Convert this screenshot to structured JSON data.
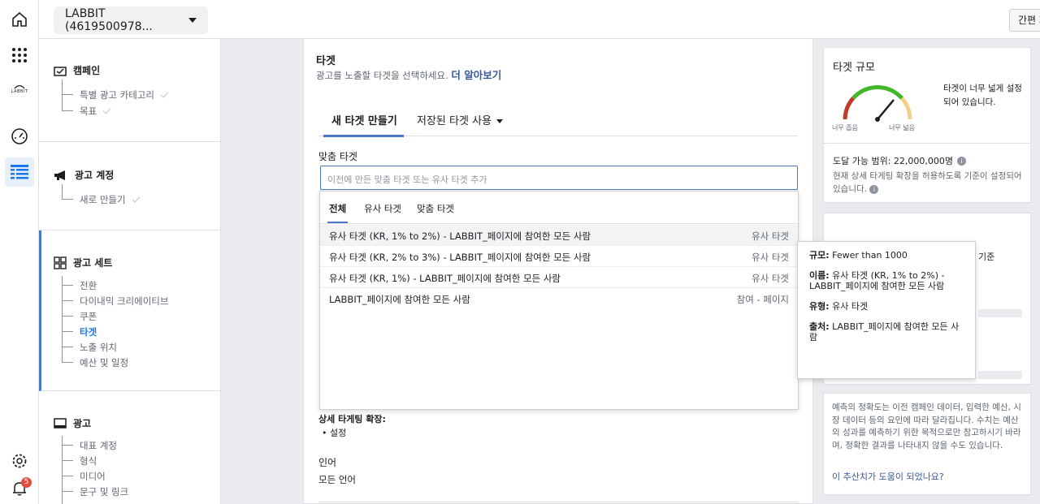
{
  "topbar": {
    "account_label": "LABBIT (4619500978...",
    "quick_label": "간편 제"
  },
  "rail": {
    "notification_count": "5",
    "logo_text": "LABBIT"
  },
  "nav": {
    "campaign": {
      "title": "캠페인",
      "items": [
        "특별 광고 카테고리",
        "목표"
      ]
    },
    "ad_account": {
      "title": "광고 계정",
      "items": [
        "새로 만들기"
      ]
    },
    "ad_set": {
      "title": "광고 세트",
      "items": [
        "전환",
        "다이내믹 크리에이티브",
        "쿠폰",
        "타겟",
        "노출 위치",
        "예산 및 일정"
      ]
    },
    "ad": {
      "title": "광고",
      "items": [
        "대표 계정",
        "형식",
        "미디어",
        "문구 및 링크"
      ]
    }
  },
  "main": {
    "title": "타겟",
    "description": "광고를 노출할 타겟을 선택하세요.",
    "learn_more": "더 알아보기",
    "tabs": [
      "새 타겟 만들기",
      "저장된 타겟 사용"
    ],
    "custom_audience_label": "맞춤 타겟",
    "search_placeholder": "이전에 만든 맞춤 타겟 또는 유사 타겟 추가",
    "detail_expansion_label": "상세 타게팅 확장:",
    "detail_expansion_value": "설정",
    "language_label": "인어",
    "language_value": "모든 언어"
  },
  "dropdown": {
    "tabs": [
      "전체",
      "유사 타겟",
      "맞춤 타겟"
    ],
    "rows": [
      {
        "name": "유사 타겟 (KR, 1% to 2%) - LABBIT_페이지에 참여한 모든 사람",
        "type": "유사 타겟"
      },
      {
        "name": "유사 타겟 (KR, 2% to 3%) - LABBIT_페이지에 참여한 모든 사람",
        "type": "유사 타겟"
      },
      {
        "name": "유사 타겟 (KR, 1%) - LABBIT_페이지에 참여한 모든 사람",
        "type": "유사 타겟"
      },
      {
        "name": "LABBIT_페이지에 참여한 모든 사람",
        "type": "참여 - 페이지"
      }
    ]
  },
  "tooltip": {
    "size_label": "규모:",
    "size_value": "Fewer than 1000",
    "name_label": "이름:",
    "name_value": "유사 타겟 (KR, 1% to 2%) - LABBIT_페이지에 참여한 모든 사람",
    "type_label": "유형:",
    "type_value": "유사 타겟",
    "source_label": "출처:",
    "source_value": "LABBIT_페이지에 참여한 모든 사람"
  },
  "right": {
    "title": "타겟 규모",
    "gauge_narrow": "너무 좁음",
    "gauge_wide": "너무 넓음",
    "gauge_message": "타겟이 너무 넓게 설정되어 있습니다.",
    "reach_label": "도달 가능 범위: 22,000,000명",
    "reach_note": "현재 상세 타게팅 확장을 허용하도록 기준이 설정되어 있습니다.",
    "partial_text": "기준",
    "accuracy_note": "예측의 정확도는 이전 캠페인 데이터, 입력한 예산, 시장 데이터 등의 요인에 따라 달라집니다. 수치는 예산의 성과를 예측하기 위한 목적으로만 참고하시기 바라며, 정확한 결과를 나타내지 않을 수도 있습니다.",
    "feedback_link": "이 추산치가 도움이 되었나요?"
  },
  "colors": {
    "accent": "#4a78c4",
    "link": "#385898",
    "badge": "#e4493a",
    "gauge_green": "#42b72a",
    "gauge_red": "#c0392b",
    "gauge_yellow": "#f2d089"
  }
}
